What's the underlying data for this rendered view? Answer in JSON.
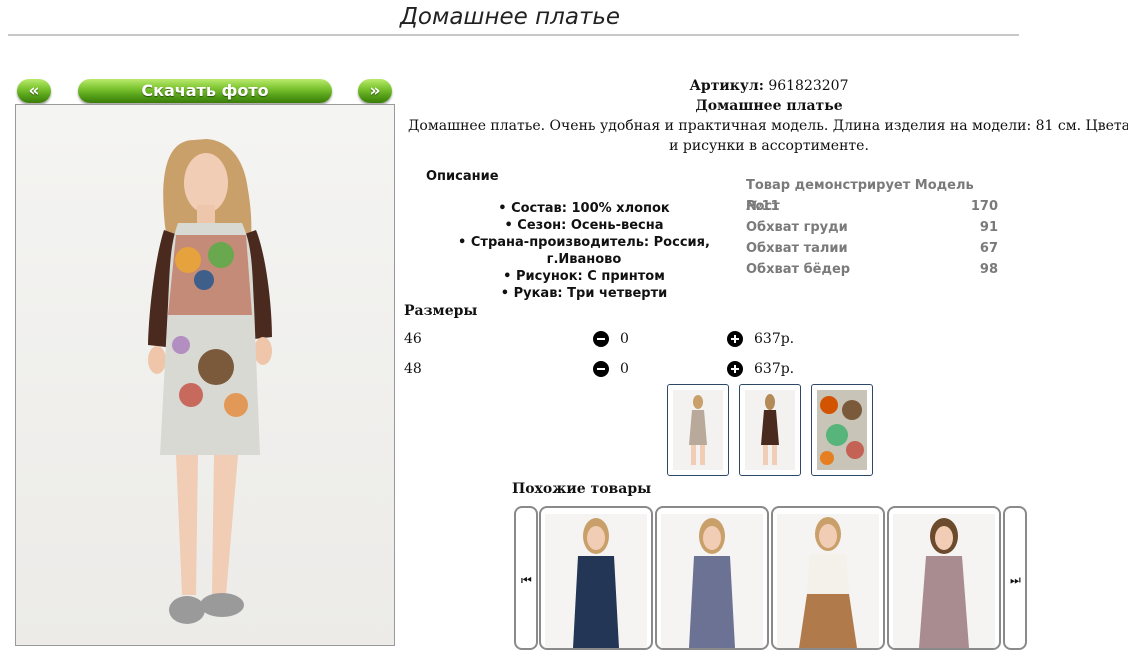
{
  "page": {
    "title": "Домашнее платье"
  },
  "gallery": {
    "prev_label": "«",
    "download_label": "Скачать фото",
    "next_label": "»"
  },
  "product": {
    "article_label": "Артикул:",
    "article_value": "961823207",
    "name": "Домашнее платье",
    "summary": "Домашнее платье. Очень удобная и практичная модель. Длина изделия на модели: 81 см. Цвета и рисунки в ассортименте."
  },
  "description": {
    "title": "Описание",
    "items": [
      "Состав: 100% хлопок",
      "Сезон: Осень-весна",
      "Страна-производитель: Россия, г.Иваново",
      "Рисунок: С принтом",
      "Рукав: Три четверти"
    ]
  },
  "model": {
    "title": "Товар демонстрирует Модель №11",
    "rows": [
      {
        "label": "Рост",
        "value": "170"
      },
      {
        "label": "Обхват груди",
        "value": "91"
      },
      {
        "label": "Обхват талии",
        "value": "67"
      },
      {
        "label": "Обхват бёдер",
        "value": "98"
      }
    ]
  },
  "sizes": {
    "title": "Размеры",
    "rows": [
      {
        "size": "46",
        "qty": "0",
        "price": "637р."
      },
      {
        "size": "48",
        "qty": "0",
        "price": "637р."
      }
    ]
  },
  "thumbnails": [
    "front-view",
    "back-view",
    "print-closeup"
  ],
  "similar": {
    "title": "Похожие товары",
    "prev_icon": "skip-back-icon",
    "next_icon": "skip-forward-icon",
    "prev_glyph": "⏮",
    "next_glyph": "⏭"
  },
  "colors": {
    "button_green": "#5aa61c",
    "thumb_border": "#2d4766",
    "model_text": "#7a7a7a"
  }
}
